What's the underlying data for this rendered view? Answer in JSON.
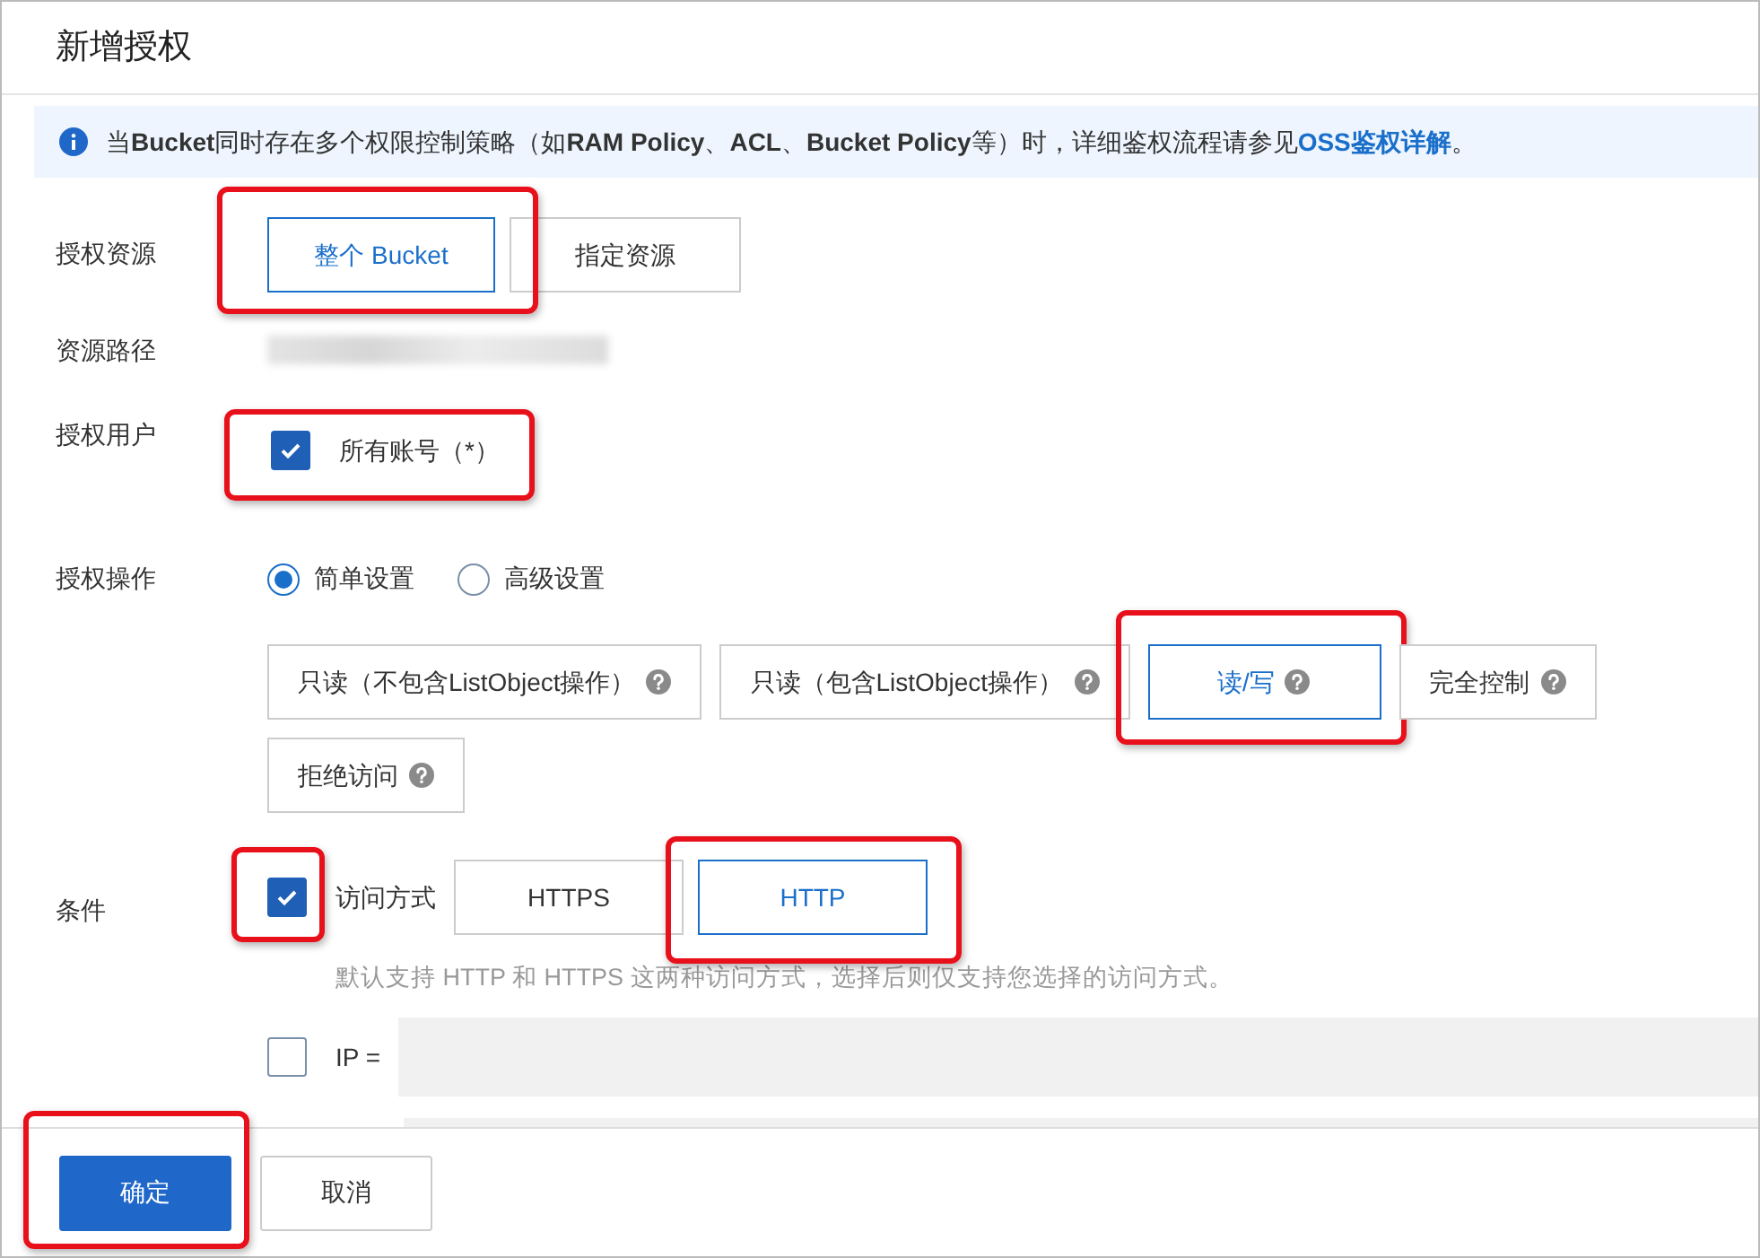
{
  "dialog": {
    "title": "新增授权"
  },
  "notice": {
    "text": "当**Bucket**同时存在多个权限控制策略（如**RAM Policy**、**ACL**、**Bucket Policy**等）时，详细鉴权流程请参见",
    "link": "OSS鉴权详解",
    "end": "。"
  },
  "fields": [
    {
      "kind": "choice",
      "label": "授权资源",
      "highlighted": true,
      "options": [
        {
          "label": "整个 Bucket",
          "selected": true
        },
        {
          "label": "指定资源",
          "selected": false
        }
      ]
    },
    {
      "kind": "masked",
      "label": "资源路径"
    },
    {
      "kind": "checkbox",
      "label": "授权用户",
      "highlighted": true,
      "checkbox": {
        "label": "所有账号（*）",
        "checked": true
      }
    },
    {
      "kind": "operations",
      "label": "授权操作",
      "radios": [
        {
          "label": "简单设置",
          "selected": true
        },
        {
          "label": "高级设置",
          "selected": false
        }
      ],
      "options": [
        {
          "label": "只读（不包含ListObject操作）",
          "selected": false,
          "highlighted": false
        },
        {
          "label": "只读（包含ListObject操作）",
          "selected": false,
          "highlighted": false
        },
        {
          "label": "读/写",
          "selected": true,
          "highlighted": true
        },
        {
          "label": "完全控制",
          "selected": false,
          "highlighted": false
        },
        {
          "label": "拒绝访问",
          "selected": false,
          "highlighted": false
        }
      ]
    },
    {
      "kind": "conditions",
      "label": "条件",
      "checked": true,
      "highlighted": true,
      "method_label": "访问方式",
      "options": [
        {
          "label": "HTTPS",
          "selected": false,
          "highlighted": false
        },
        {
          "label": "HTTP",
          "selected": true,
          "highlighted": true
        }
      ],
      "hint": "默认支持 HTTP 和 HTTPS 这两种访问方式，选择后则仅支持您选择的访问方式。",
      "ip": {
        "label": "IP =",
        "checked": false
      }
    }
  ],
  "footer": {
    "buttons": [
      {
        "label": "确定",
        "kind": "primary",
        "highlighted": true
      },
      {
        "label": "取消",
        "kind": "default",
        "highlighted": false
      }
    ]
  }
}
